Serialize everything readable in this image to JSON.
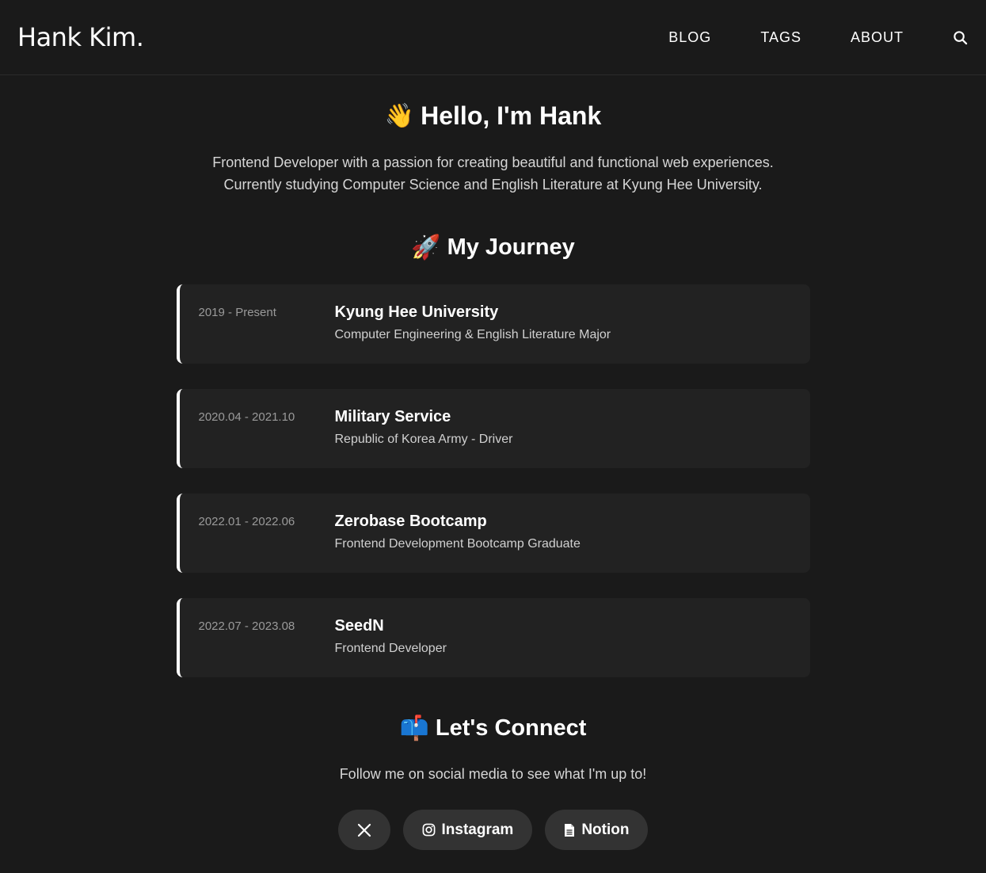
{
  "header": {
    "logo": "Hank Kim.",
    "nav": [
      {
        "label": "BLOG"
      },
      {
        "label": "TAGS"
      },
      {
        "label": "ABOUT"
      }
    ],
    "search_icon": "search-icon"
  },
  "hero": {
    "emoji": "👋",
    "title": "Hello, I'm Hank",
    "intro_line1": "Frontend Developer with a passion for creating beautiful and functional web experiences.",
    "intro_line2": "Currently studying Computer Science and English Literature at Kyung Hee University."
  },
  "journey": {
    "emoji": "🚀",
    "title": "My Journey",
    "items": [
      {
        "date": "2019 - Present",
        "title": "Kyung Hee University",
        "subtitle": "Computer Engineering & English Literature Major"
      },
      {
        "date": "2020.04 - 2021.10",
        "title": "Military Service",
        "subtitle": "Republic of Korea Army - Driver"
      },
      {
        "date": "2022.01 - 2022.06",
        "title": "Zerobase Bootcamp",
        "subtitle": "Frontend Development Bootcamp Graduate"
      },
      {
        "date": "2022.07 - 2023.08",
        "title": "SeedN",
        "subtitle": "Frontend Developer"
      }
    ]
  },
  "connect": {
    "emoji": "📫",
    "title": "Let's Connect",
    "text": "Follow me on social media to see what I'm up to!",
    "links": [
      {
        "label": "",
        "icon": "x-logo-icon"
      },
      {
        "label": "Instagram",
        "icon": "instagram-icon"
      },
      {
        "label": "Notion",
        "icon": "document-icon"
      }
    ]
  },
  "colors": {
    "background": "#1a1a1a",
    "card": "#222222",
    "accent_border": "#ffffff",
    "button": "#333333"
  }
}
